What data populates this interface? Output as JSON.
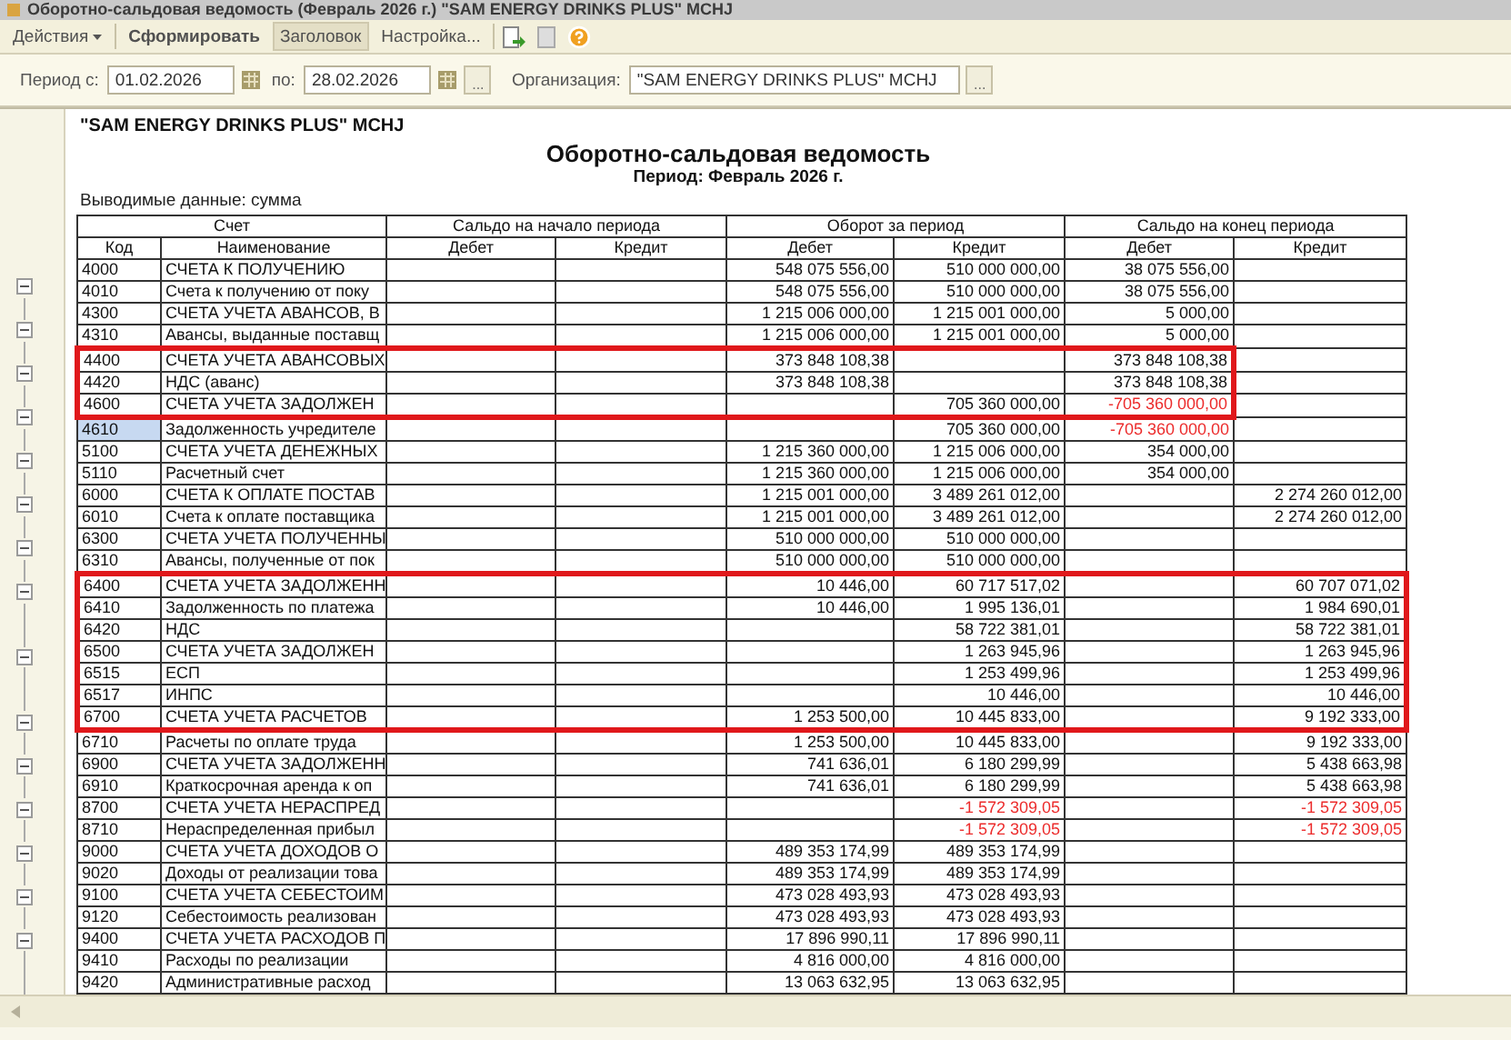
{
  "window": {
    "title": "Оборотно-сальдовая ведомость (Февраль 2026 г.) \"SAM ENERGY DRINKS PLUS\" MCHJ"
  },
  "toolbar": {
    "actions": "Действия",
    "generate": "Сформировать",
    "header": {
      "label": "Заголовок",
      "pressed": true
    },
    "settings": "Настройка..."
  },
  "filter": {
    "period_from_label": "Период с:",
    "period_from": "01.02.2026",
    "period_to_label": "по:",
    "period_to": "28.02.2026",
    "period_button": "...",
    "organization_label": "Организация:",
    "organization": "\"SAM ENERGY DRINKS PLUS\" MCHJ",
    "organization_button": "..."
  },
  "report": {
    "company": "\"SAM ENERGY DRINKS PLUS\" MCHJ",
    "title": "Оборотно-сальдовая ведомость",
    "period": "Период: Февраль 2026 г.",
    "output_note": "Выводимые данные: сумма",
    "group_headers": [
      "Счет",
      "Сальдо на начало периода",
      "Оборот за период",
      "Сальдо на конец периода"
    ],
    "columns": [
      "Код",
      "Наименование",
      "Дебет",
      "Кредит",
      "Дебет",
      "Кредит",
      "Дебет",
      "Кредит"
    ],
    "frames": [
      {
        "kind": "to_end_debit"
      },
      {
        "kind": "to_end_credit"
      }
    ],
    "rows": [
      {
        "code": "4000",
        "name": "СЧЕТА К ПОЛУЧЕНИЮ",
        "kind": "group",
        "selected": false,
        "framed": false,
        "td": {
          "text": "548 075 556,00",
          "red": false
        },
        "tc": {
          "text": "510 000 000,00",
          "red": false
        },
        "ed": {
          "text": "38 075 556,00",
          "red": false
        }
      },
      {
        "code": "4010",
        "name": "Счета к получению от поку",
        "kind": "account",
        "selected": false,
        "framed": false,
        "td": {
          "text": "548 075 556,00",
          "red": false
        },
        "tc": {
          "text": "510 000 000,00",
          "red": false
        },
        "ed": {
          "text": "38 075 556,00",
          "red": false
        }
      },
      {
        "code": "4300",
        "name": "СЧЕТА УЧЕТА АВАНСОВ, В",
        "kind": "group",
        "selected": false,
        "framed": false,
        "td": {
          "text": "1 215 006 000,00",
          "red": false
        },
        "tc": {
          "text": "1 215 001 000,00",
          "red": false
        },
        "ed": {
          "text": "5 000,00",
          "red": false
        }
      },
      {
        "code": "4310",
        "name": "Авансы, выданные поставщ",
        "kind": "account",
        "selected": false,
        "framed": false,
        "td": {
          "text": "1 215 006 000,00",
          "red": false
        },
        "tc": {
          "text": "1 215 001 000,00",
          "red": false
        },
        "ed": {
          "text": "5 000,00",
          "red": false
        }
      },
      {
        "code": "4400",
        "name": "СЧЕТА УЧЕТА АВАНСОВЫХ",
        "kind": "group",
        "selected": false,
        "framed": true,
        "td": {
          "text": "373 848 108,38",
          "red": false
        },
        "ed": {
          "text": "373 848 108,38",
          "red": false
        }
      },
      {
        "code": "4420",
        "name": "НДС (аванс)",
        "kind": "account",
        "selected": false,
        "framed": true,
        "td": {
          "text": "373 848 108,38",
          "red": false
        },
        "ed": {
          "text": "373 848 108,38",
          "red": false
        }
      },
      {
        "code": "4600",
        "name": "СЧЕТА УЧЕТА ЗАДОЛЖЕН",
        "kind": "group",
        "selected": false,
        "framed": true,
        "tc": {
          "text": "705 360 000,00",
          "red": false
        },
        "ed": {
          "text": "-705 360 000,00",
          "red": true
        }
      },
      {
        "code": "4610",
        "name": "Задолженность учредителе",
        "kind": "account",
        "selected": true,
        "framed": false,
        "tc": {
          "text": "705 360 000,00",
          "red": false
        },
        "ed": {
          "text": "-705 360 000,00",
          "red": true
        }
      },
      {
        "code": "5100",
        "name": "СЧЕТА УЧЕТА ДЕНЕЖНЫХ",
        "kind": "group",
        "selected": false,
        "framed": false,
        "td": {
          "text": "1 215 360 000,00",
          "red": false
        },
        "tc": {
          "text": "1 215 006 000,00",
          "red": false
        },
        "ed": {
          "text": "354 000,00",
          "red": false
        }
      },
      {
        "code": "5110",
        "name": "Расчетный счет",
        "kind": "account",
        "selected": false,
        "framed": false,
        "td": {
          "text": "1 215 360 000,00",
          "red": false
        },
        "tc": {
          "text": "1 215 006 000,00",
          "red": false
        },
        "ed": {
          "text": "354 000,00",
          "red": false
        }
      },
      {
        "code": "6000",
        "name": "СЧЕТА  К ОПЛАТЕ ПОСТАВ",
        "kind": "group",
        "selected": false,
        "framed": false,
        "td": {
          "text": "1 215 001 000,00",
          "red": false
        },
        "tc": {
          "text": "3 489 261 012,00",
          "red": false
        },
        "ec": {
          "text": "2 274 260 012,00",
          "red": false
        }
      },
      {
        "code": "6010",
        "name": "Счета к оплате поставщика",
        "kind": "account",
        "selected": false,
        "framed": false,
        "td": {
          "text": "1 215 001 000,00",
          "red": false
        },
        "tc": {
          "text": "3 489 261 012,00",
          "red": false
        },
        "ec": {
          "text": "2 274 260 012,00",
          "red": false
        }
      },
      {
        "code": "6300",
        "name": "СЧЕТА УЧЕТА ПОЛУЧЕННЫ",
        "kind": "group",
        "selected": false,
        "framed": false,
        "td": {
          "text": "510 000 000,00",
          "red": false
        },
        "tc": {
          "text": "510 000 000,00",
          "red": false
        }
      },
      {
        "code": "6310",
        "name": "Авансы, полученные от пок",
        "kind": "account",
        "selected": false,
        "framed": false,
        "td": {
          "text": "510 000 000,00",
          "red": false
        },
        "tc": {
          "text": "510 000 000,00",
          "red": false
        }
      },
      {
        "code": "6400",
        "name": "СЧЕТА УЧЕТА ЗАДОЛЖЕНН",
        "kind": "group",
        "selected": false,
        "framed": true,
        "td": {
          "text": "10 446,00",
          "red": false
        },
        "tc": {
          "text": "60 717 517,02",
          "red": false
        },
        "ec": {
          "text": "60 707 071,02",
          "red": false
        }
      },
      {
        "code": "6410",
        "name": "Задолженность по платежа",
        "kind": "account",
        "selected": false,
        "framed": true,
        "td": {
          "text": "10 446,00",
          "red": false
        },
        "tc": {
          "text": "1 995 136,01",
          "red": false
        },
        "ec": {
          "text": "1 984 690,01",
          "red": false
        }
      },
      {
        "code": "6420",
        "name": "НДС",
        "kind": "account",
        "selected": false,
        "framed": true,
        "tc": {
          "text": "58 722 381,01",
          "red": false
        },
        "ec": {
          "text": "58 722 381,01",
          "red": false
        }
      },
      {
        "code": "6500",
        "name": "СЧЕТА УЧЕТА  ЗАДОЛЖЕН",
        "kind": "group",
        "selected": false,
        "framed": true,
        "tc": {
          "text": "1 263 945,96",
          "red": false
        },
        "ec": {
          "text": "1 263 945,96",
          "red": false
        }
      },
      {
        "code": "6515",
        "name": "ЕСП",
        "kind": "account",
        "selected": false,
        "framed": true,
        "tc": {
          "text": "1 253 499,96",
          "red": false
        },
        "ec": {
          "text": "1 253 499,96",
          "red": false
        }
      },
      {
        "code": "6517",
        "name": "ИНПС",
        "kind": "account",
        "selected": false,
        "framed": true,
        "tc": {
          "text": "10 446,00",
          "red": false
        },
        "ec": {
          "text": "10 446,00",
          "red": false
        }
      },
      {
        "code": "6700",
        "name": "СЧЕТА УЧЕТА РАСЧЕТОВ",
        "kind": "group",
        "selected": false,
        "framed": true,
        "td": {
          "text": "1 253 500,00",
          "red": false
        },
        "tc": {
          "text": "10 445 833,00",
          "red": false
        },
        "ec": {
          "text": "9 192 333,00",
          "red": false
        }
      },
      {
        "code": "6710",
        "name": "Расчеты по оплате труда",
        "kind": "account",
        "selected": false,
        "framed": false,
        "td": {
          "text": "1 253 500,00",
          "red": false
        },
        "tc": {
          "text": "10 445 833,00",
          "red": false
        },
        "ec": {
          "text": "9 192 333,00",
          "red": false
        }
      },
      {
        "code": "6900",
        "name": "СЧЕТА УЧЕТА ЗАДОЛЖЕНН",
        "kind": "group",
        "selected": false,
        "framed": false,
        "td": {
          "text": "741 636,01",
          "red": false
        },
        "tc": {
          "text": "6 180 299,99",
          "red": false
        },
        "ec": {
          "text": "5 438 663,98",
          "red": false
        }
      },
      {
        "code": "6910",
        "name": "Краткосрочная аренда к оп",
        "kind": "account",
        "selected": false,
        "framed": false,
        "td": {
          "text": "741 636,01",
          "red": false
        },
        "tc": {
          "text": "6 180 299,99",
          "red": false
        },
        "ec": {
          "text": "5 438 663,98",
          "red": false
        }
      },
      {
        "code": "8700",
        "name": "СЧЕТА УЧЕТА  НЕРАСПРЕД",
        "kind": "group",
        "selected": false,
        "framed": false,
        "tc": {
          "text": "-1 572 309,05",
          "red": true
        },
        "ec": {
          "text": "-1 572 309,05",
          "red": true
        }
      },
      {
        "code": "8710",
        "name": "Нераспределенная прибыл",
        "kind": "account",
        "selected": false,
        "framed": false,
        "tc": {
          "text": "-1 572 309,05",
          "red": true
        },
        "ec": {
          "text": "-1 572 309,05",
          "red": true
        }
      },
      {
        "code": "9000",
        "name": "СЧЕТА УЧЕТА ДОХОДОВ О",
        "kind": "group",
        "selected": false,
        "framed": false,
        "td": {
          "text": "489 353 174,99",
          "red": false
        },
        "tc": {
          "text": "489 353 174,99",
          "red": false
        }
      },
      {
        "code": "9020",
        "name": "Доходы от реализации това",
        "kind": "account",
        "selected": false,
        "framed": false,
        "td": {
          "text": "489 353 174,99",
          "red": false
        },
        "tc": {
          "text": "489 353 174,99",
          "red": false
        }
      },
      {
        "code": "9100",
        "name": "СЧЕТА УЧЕТА СЕБЕСТОИМ",
        "kind": "group",
        "selected": false,
        "framed": false,
        "td": {
          "text": "473 028 493,93",
          "red": false
        },
        "tc": {
          "text": "473 028 493,93",
          "red": false
        }
      },
      {
        "code": "9120",
        "name": "Себестоимость реализован",
        "kind": "account",
        "selected": false,
        "framed": false,
        "td": {
          "text": "473 028 493,93",
          "red": false
        },
        "tc": {
          "text": "473 028 493,93",
          "red": false
        }
      },
      {
        "code": "9400",
        "name": "СЧЕТА УЧЕТА РАСХОДОВ П",
        "kind": "group",
        "selected": false,
        "framed": false,
        "td": {
          "text": "17 896 990,11",
          "red": false
        },
        "tc": {
          "text": "17 896 990,11",
          "red": false
        }
      },
      {
        "code": "9410",
        "name": "Расходы по реализации",
        "kind": "account",
        "selected": false,
        "framed": false,
        "td": {
          "text": "4 816 000,00",
          "red": false
        },
        "tc": {
          "text": "4 816 000,00",
          "red": false
        }
      },
      {
        "code": "9420",
        "name": "Административные расход",
        "kind": "account",
        "selected": false,
        "framed": false,
        "td": {
          "text": "13 063 632,95",
          "red": false
        },
        "tc": {
          "text": "13 063 632,95",
          "red": false
        }
      }
    ]
  }
}
